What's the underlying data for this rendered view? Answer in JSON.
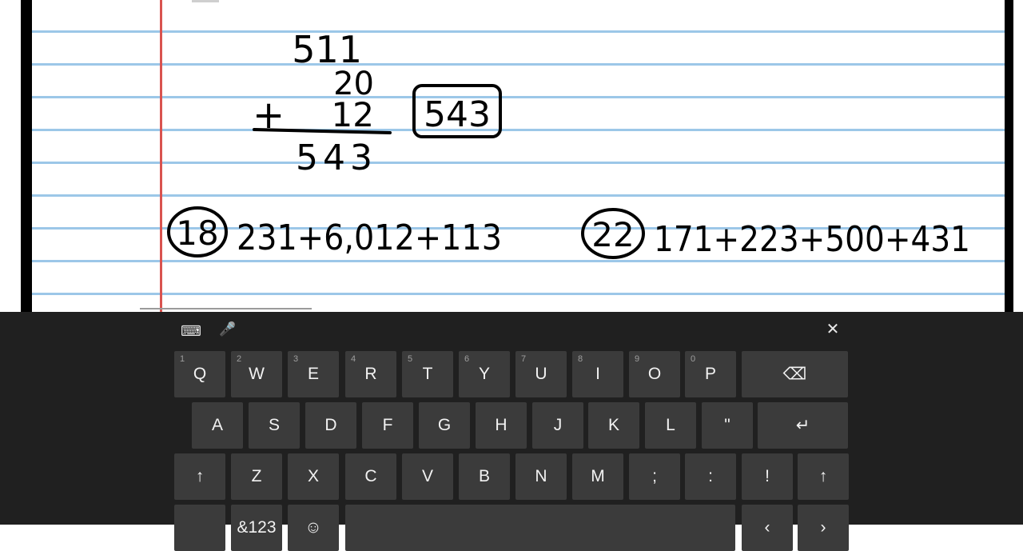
{
  "worksheet": {
    "addition": {
      "addend1": "511",
      "addend2": "20",
      "operator": "+",
      "addend3": "12",
      "sum": "543",
      "boxed_answer": "543"
    },
    "problems": [
      {
        "number": "18",
        "expression": "231+6,012+113"
      },
      {
        "number": "22",
        "expression": "171+223+500+431"
      }
    ]
  },
  "keyboard": {
    "tools": {
      "keyboard_settings": "⌨",
      "microphone": "🎤",
      "close": "✕"
    },
    "row1": [
      {
        "label": "Q",
        "hint": "1"
      },
      {
        "label": "W",
        "hint": "2"
      },
      {
        "label": "E",
        "hint": "3"
      },
      {
        "label": "R",
        "hint": "4"
      },
      {
        "label": "T",
        "hint": "5"
      },
      {
        "label": "Y",
        "hint": "6"
      },
      {
        "label": "U",
        "hint": "7"
      },
      {
        "label": "I",
        "hint": "8"
      },
      {
        "label": "O",
        "hint": "9"
      },
      {
        "label": "P",
        "hint": "0"
      },
      {
        "label": "⌫",
        "hint": ""
      }
    ],
    "row2": [
      {
        "label": "A"
      },
      {
        "label": "S"
      },
      {
        "label": "D"
      },
      {
        "label": "F"
      },
      {
        "label": "G"
      },
      {
        "label": "H"
      },
      {
        "label": "J"
      },
      {
        "label": "K"
      },
      {
        "label": "L"
      },
      {
        "label": "\""
      },
      {
        "label": "↵"
      }
    ],
    "row3": [
      {
        "label": "↑"
      },
      {
        "label": "Z"
      },
      {
        "label": "X"
      },
      {
        "label": "C"
      },
      {
        "label": "V"
      },
      {
        "label": "B"
      },
      {
        "label": "N"
      },
      {
        "label": "M"
      },
      {
        "label": ";"
      },
      {
        "label": ":"
      },
      {
        "label": "!"
      },
      {
        "label": "↑"
      }
    ],
    "row4": [
      {
        "label": ""
      },
      {
        "label": "&123"
      },
      {
        "label": "☺"
      },
      {
        "label": ""
      },
      {
        "label": "‹"
      },
      {
        "label": "›"
      }
    ]
  }
}
